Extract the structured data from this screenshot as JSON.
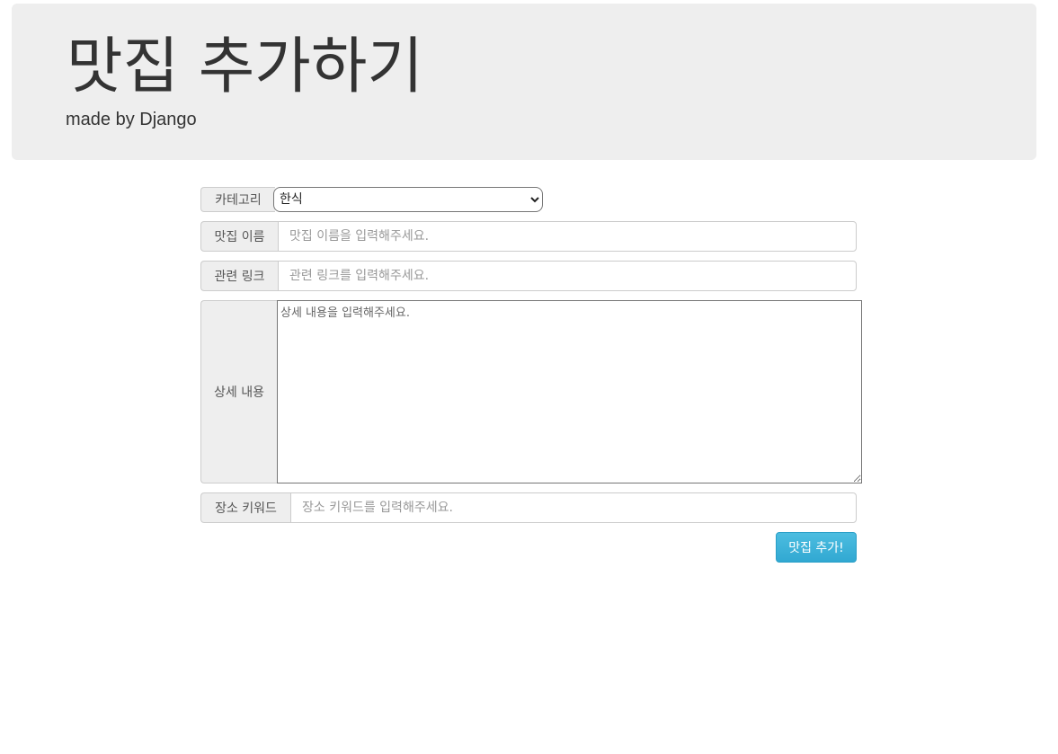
{
  "header": {
    "title": "맛집 추가하기",
    "subtitle": "made by Django"
  },
  "form": {
    "category": {
      "label": "카테고리",
      "selected": "한식"
    },
    "name": {
      "label": "맛집 이름",
      "placeholder": "맛집 이름을 입력해주세요."
    },
    "link": {
      "label": "관련 링크",
      "placeholder": "관련 링크를 입력해주세요."
    },
    "detail": {
      "label": "상세 내용",
      "placeholder": "상세 내용을 입력해주세요."
    },
    "keyword": {
      "label": "장소 키워드",
      "placeholder": "장소 키워드를 입력해주세요."
    },
    "submit_label": "맛집 추가!"
  },
  "colors": {
    "header_bg": "#eeeeee",
    "submit_bg": "#3fb4da"
  }
}
